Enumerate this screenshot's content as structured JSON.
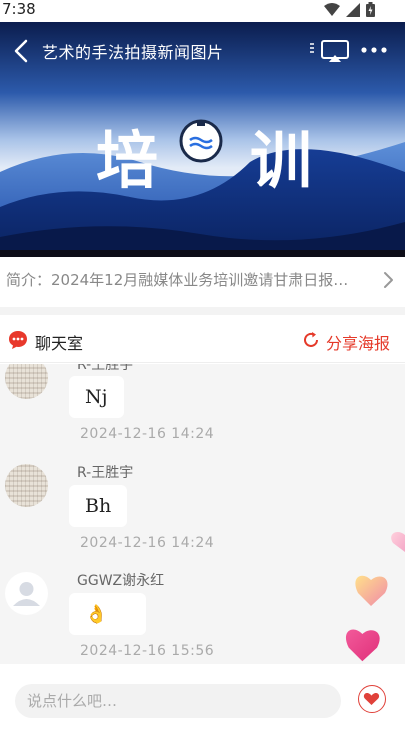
{
  "status_bar": {
    "time": "7:38"
  },
  "header": {
    "title": "艺术的手法拍摄新闻图片"
  },
  "banner": {
    "text_left": "培",
    "text_right": "训"
  },
  "intro": {
    "text": "简介：2024年12月融媒体业务培训邀请甘肃日报…"
  },
  "chat_room": {
    "title": "聊天室",
    "share_label": "分享海报"
  },
  "messages": [
    {
      "sender": "R-王胜宇",
      "content": "Nj",
      "time": "2024-12-16  14:24",
      "avatar": "pattern"
    },
    {
      "sender": "R-王胜宇",
      "content": "Bh",
      "time": "2024-12-16  14:24",
      "avatar": "pattern"
    },
    {
      "sender": "GGWZ谢永红",
      "content": "👌",
      "time": "2024-12-16  15:56",
      "avatar": "default-user-icon"
    }
  ],
  "input": {
    "placeholder": "说点什么吧…"
  },
  "colors": {
    "accent": "#e53a2a",
    "banner_dark": "#0d2f86",
    "list_bg": "#f5f5f5"
  }
}
